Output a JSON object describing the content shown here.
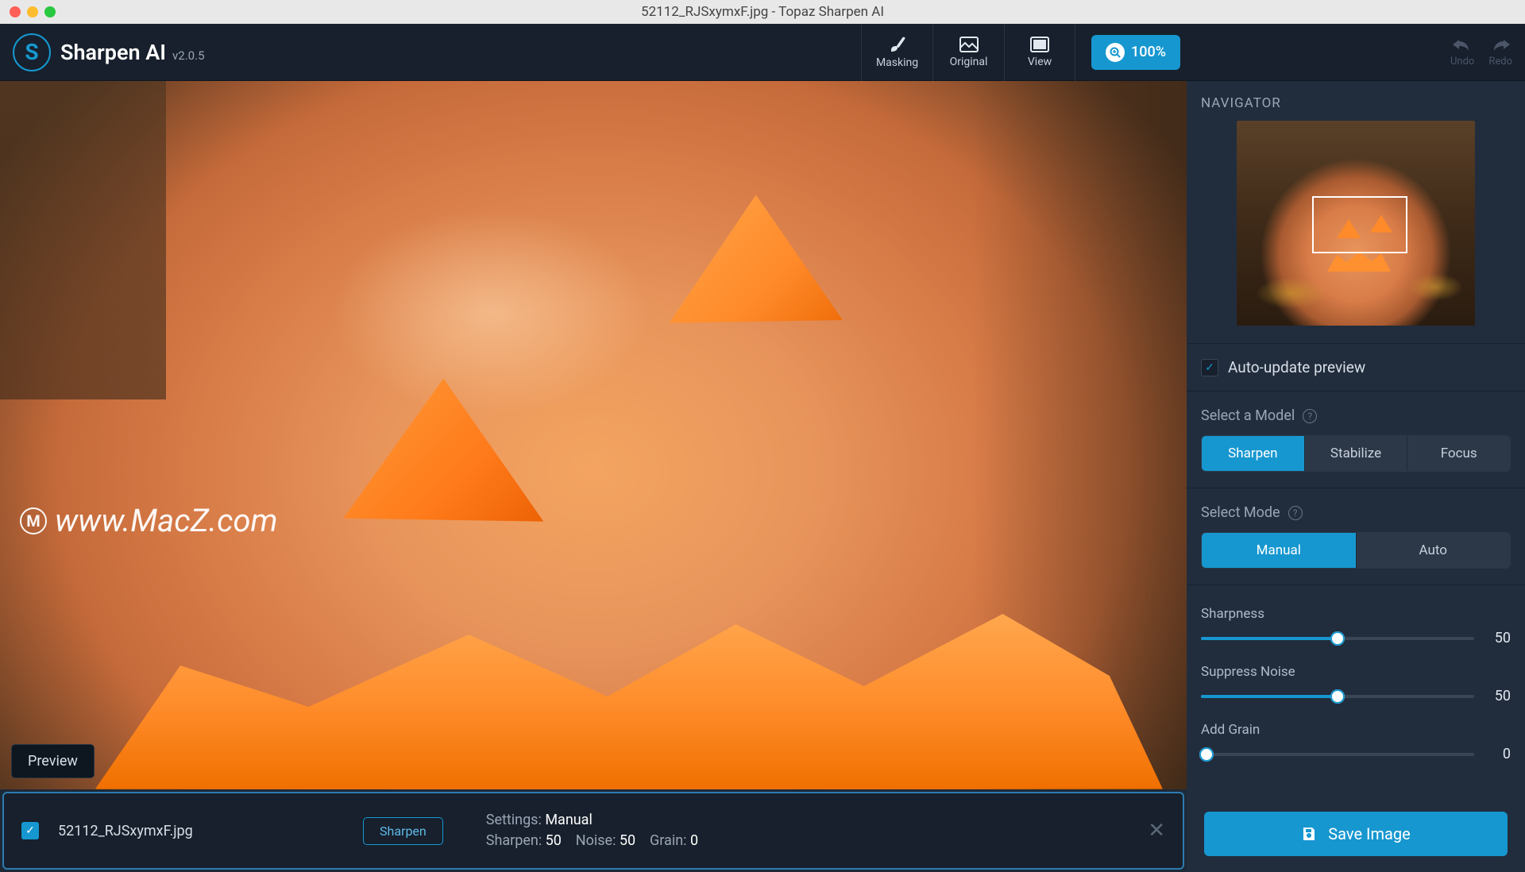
{
  "window": {
    "title": "52112_RJSxymxF.jpg - Topaz Sharpen AI"
  },
  "brand": {
    "name": "Sharpen AI",
    "version": "v2.0.5",
    "logo_letter": "S"
  },
  "toolbar": {
    "masking": "Masking",
    "original": "Original",
    "view": "View",
    "zoom": "100%",
    "undo": "Undo",
    "redo": "Redo"
  },
  "canvas": {
    "preview_btn": "Preview",
    "watermark": "www.MacZ.com",
    "watermark_badge": "M"
  },
  "file": {
    "name": "52112_RJSxymxF.jpg",
    "badge": "Sharpen",
    "settings_label": "Settings:",
    "mode_value": "Manual",
    "sharpen_label": "Sharpen:",
    "sharpen_value": "50",
    "noise_label": "Noise:",
    "noise_value": "50",
    "grain_label": "Grain:",
    "grain_value": "0"
  },
  "sidebar": {
    "navigator_title": "NAVIGATOR",
    "auto_update": "Auto-update preview",
    "select_model_label": "Select a Model",
    "models": {
      "sharpen": "Sharpen",
      "stabilize": "Stabilize",
      "focus": "Focus"
    },
    "select_mode_label": "Select Mode",
    "modes": {
      "manual": "Manual",
      "auto": "Auto"
    },
    "sliders": {
      "sharpness": {
        "label": "Sharpness",
        "value": "50",
        "pct": 50
      },
      "suppress_noise": {
        "label": "Suppress Noise",
        "value": "50",
        "pct": 50
      },
      "add_grain": {
        "label": "Add Grain",
        "value": "0",
        "pct": 0
      }
    },
    "save_btn": "Save Image"
  }
}
